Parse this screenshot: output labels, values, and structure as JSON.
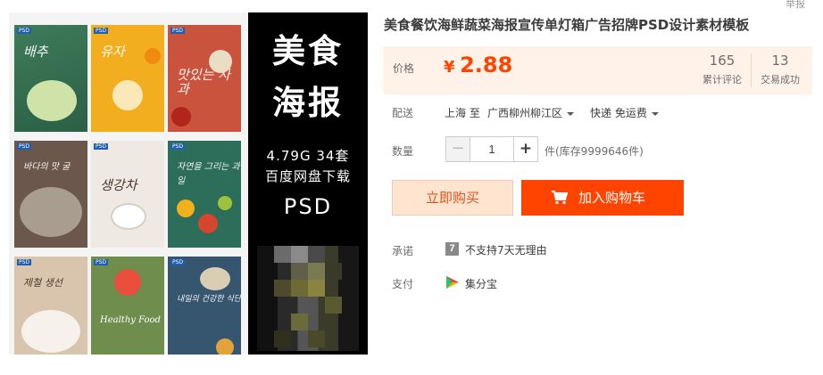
{
  "product": {
    "title": "美食餐饮海鲜蔬菜海报宣传单灯箱广告招牌PSD设计素材模板",
    "report_link": "举报"
  },
  "image": {
    "banner_line1": "美食",
    "banner_line2": "海报",
    "banner_size": "4.79G  34套",
    "banner_pan": "百度网盘下载",
    "banner_format": "PSD",
    "thumb_tag": "PSD",
    "thumb_words": [
      "배추",
      "유자",
      "맛있는 사과",
      "바다의 맛 굴",
      "생강차",
      "자연을 그리는 과일",
      "제철 생선",
      "Healthy Food",
      "내일의 건강한 식단"
    ]
  },
  "price": {
    "label": "价格",
    "currency": "¥",
    "value": "2.88",
    "reviews_count": "165",
    "reviews_label": "累计评论",
    "sales_count": "13",
    "sales_label": "交易成功"
  },
  "shipping": {
    "label": "配送",
    "from": "上海 至",
    "to": "广西柳州柳江区",
    "method": "快递 免运费"
  },
  "quantity": {
    "label": "数量",
    "minus": "−",
    "value": "1",
    "plus": "+",
    "stock": "件(库存9999646件)"
  },
  "actions": {
    "buy_now": "立即购买",
    "add_to_cart": "加入购物车"
  },
  "promise": {
    "label": "承诺",
    "icon_glyph": "7",
    "text": "不支持7天无理由"
  },
  "payment": {
    "label": "支付",
    "text": "集分宝"
  },
  "colors": {
    "accent": "#ff4400",
    "price_bg": "#fff2e8",
    "buy_now_bg": "#ffe4d0"
  },
  "icons": {
    "cart": "shopping-cart-icon",
    "promise": "no-7-day-return-icon",
    "payment": "jifenbao-icon",
    "dropdown": "caret-down-icon"
  }
}
